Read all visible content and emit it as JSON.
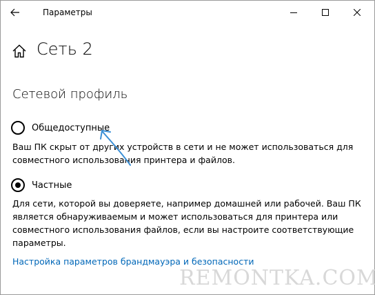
{
  "window": {
    "app_title": "Параметры"
  },
  "header": {
    "page_title": "Сеть 2"
  },
  "network_profile": {
    "section_title": "Сетевой профиль",
    "options": [
      {
        "label": "Общедоступные",
        "selected": false,
        "description": "Ваш ПК скрыт от других устройств в сети и не может использоваться для совместного использования принтера и файлов."
      },
      {
        "label": "Частные",
        "selected": true,
        "description": "Для сети, которой вы доверяете, например домашней или рабочей. Ваш ПК является обнаруживаемым и может использоваться для принтера или совместного использования файлов, если вы настроите соответствующие параметры."
      }
    ]
  },
  "firewall_link": {
    "label": "Настройка параметров брандмауэра и безопасности"
  },
  "watermark": {
    "text": "REMONTKA.COM"
  },
  "colors": {
    "link": "#0067b8",
    "annotation_arrow": "#3a8fd6",
    "watermark": "#d8d8d8"
  }
}
